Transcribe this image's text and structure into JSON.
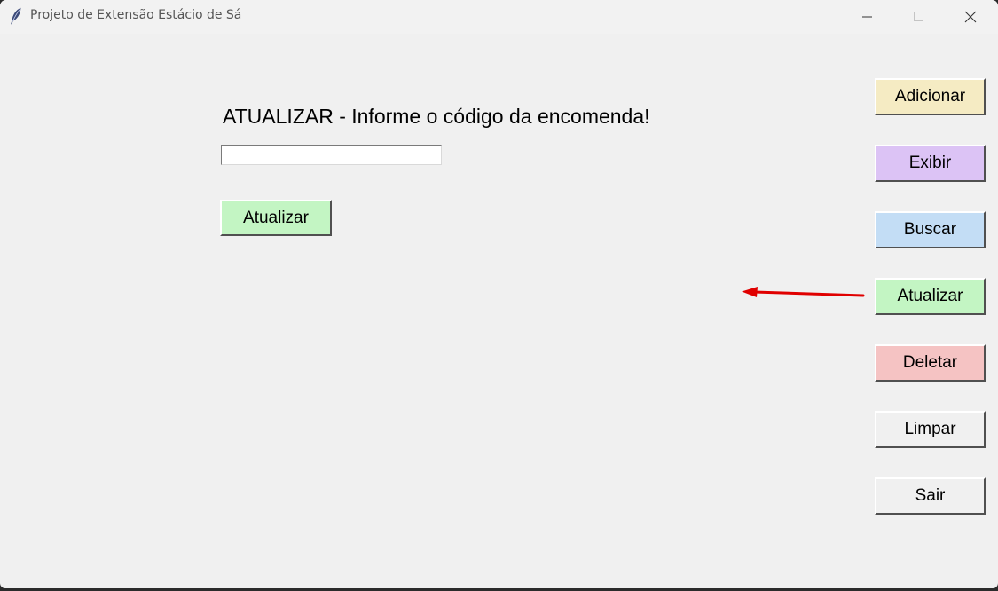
{
  "window": {
    "title": "Projeto de Extensão Estácio de Sá",
    "icons": {
      "app": "feather-icon",
      "minimize": "minimize-icon",
      "maximize": "maximize-icon",
      "close": "close-icon"
    }
  },
  "form": {
    "prompt": "ATUALIZAR - Informe o código da encomenda!",
    "code_value": "",
    "submit_label": "Atualizar",
    "submit_color": "#c3f5c3"
  },
  "menu": {
    "items": [
      {
        "label": "Adicionar",
        "color": "#f5ebc3"
      },
      {
        "label": "Exibir",
        "color": "#dcc3f5"
      },
      {
        "label": "Buscar",
        "color": "#c3ddf5"
      },
      {
        "label": "Atualizar",
        "color": "#c3f5c3"
      },
      {
        "label": "Deletar",
        "color": "#f5c3c3"
      },
      {
        "label": "Limpar",
        "color": "#f0f0f0"
      },
      {
        "label": "Sair",
        "color": "#f0f0f0"
      }
    ]
  },
  "annotation": {
    "arrow_color": "#e00000",
    "points_to": "menu-button-atualizar"
  }
}
